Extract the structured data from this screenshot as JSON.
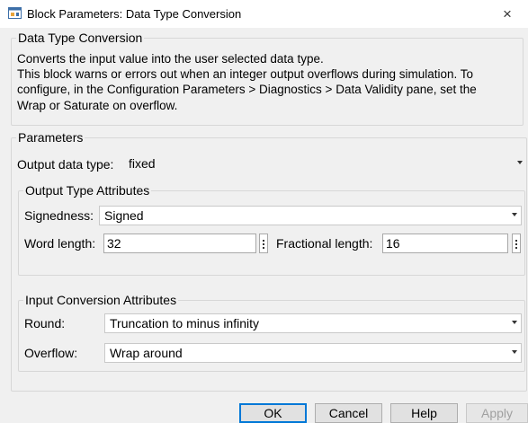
{
  "window": {
    "title": "Block Parameters: Data Type Conversion",
    "close_glyph": "×"
  },
  "block_group": {
    "legend": "Data Type Conversion",
    "description_lines": [
      "Converts the input value into the user selected data type.",
      "This block warns or errors out when an integer output overflows during simulation. To",
      "configure, in the Configuration Parameters > Diagnostics > Data Validity pane, set the",
      "Wrap or Saturate on overflow."
    ]
  },
  "parameters": {
    "legend": "Parameters",
    "output_data_type": {
      "label": "Output data type:",
      "value": "fixed"
    },
    "output_type_attributes": {
      "legend": "Output Type Attributes",
      "signedness": {
        "label": "Signedness:",
        "value": "Signed"
      },
      "word_length": {
        "label": "Word length:",
        "value": "32"
      },
      "fractional_length": {
        "label": "Fractional length:",
        "value": "16"
      }
    },
    "input_conversion_attributes": {
      "legend": "Input Conversion Attributes",
      "round": {
        "label": "Round:",
        "value": "Truncation to minus infinity"
      },
      "overflow": {
        "label": "Overflow:",
        "value": "Wrap around"
      }
    }
  },
  "buttons": {
    "ok": "OK",
    "cancel": "Cancel",
    "help": "Help",
    "apply": "Apply"
  },
  "colors": {
    "window_bg": "#f0f0f0",
    "default_button_border": "#0078d7",
    "disabled_text": "#a0a0a0"
  },
  "icons": {
    "app_icon": "simulink-block-icon",
    "close_icon": "close-icon",
    "dropdown_icon": "chevron-down-icon",
    "spinner_icon": "spinner-dots-icon"
  }
}
